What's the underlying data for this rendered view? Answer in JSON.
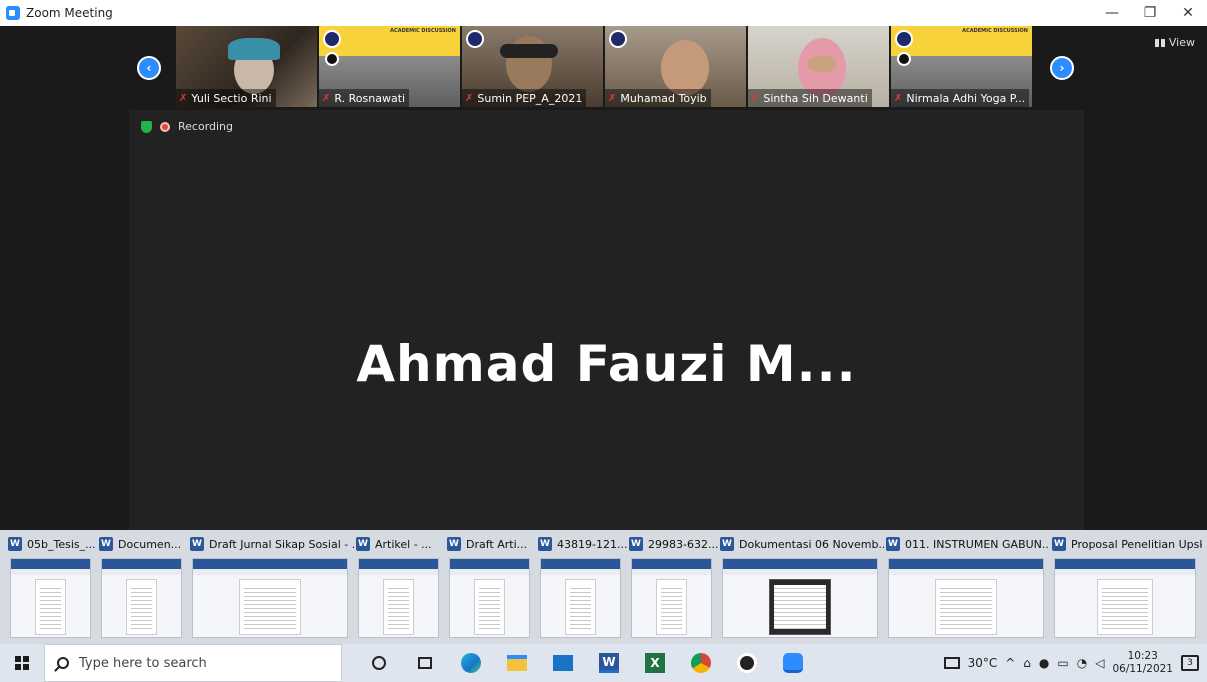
{
  "window": {
    "title": "Zoom Meeting",
    "minimize": "—",
    "restore": "❐",
    "close": "✕"
  },
  "gallery": {
    "prev": "‹",
    "next": "›",
    "view_label": "View",
    "participants": [
      {
        "name": "Yuli Sectio Rini"
      },
      {
        "name": "R. Rosnawati"
      },
      {
        "name": "Sumin PEP_A_2021"
      },
      {
        "name": "Muhamad Toyib"
      },
      {
        "name": "Sintha Sih Dewanti"
      },
      {
        "name": "Nirmala Adhi Yoga P..."
      }
    ],
    "poster_banner": "ACADEMIC DISCUSSION"
  },
  "stage": {
    "recording": "Recording",
    "speaker_name": "Ahmad Fauzi M..."
  },
  "thumbnails": [
    {
      "title": "05b_Tesis_..."
    },
    {
      "title": "Documen..."
    },
    {
      "title": "Draft Jurnal Sikap Sosial - ..."
    },
    {
      "title": "Artikel - ..."
    },
    {
      "title": "Draft Arti..."
    },
    {
      "title": "43819-121..."
    },
    {
      "title": "29983-632..."
    },
    {
      "title": "Dokumentasi 06 Novemb..."
    },
    {
      "title": "011. INSTRUMEN GABUN..."
    },
    {
      "title": "Proposal Penelitian Upskil..."
    }
  ],
  "word_icon_letter": "W",
  "taskbar": {
    "search_placeholder": "Type here to search",
    "weather": "30°C",
    "time": "10:23",
    "date": "06/11/2021",
    "notifications": "3"
  }
}
